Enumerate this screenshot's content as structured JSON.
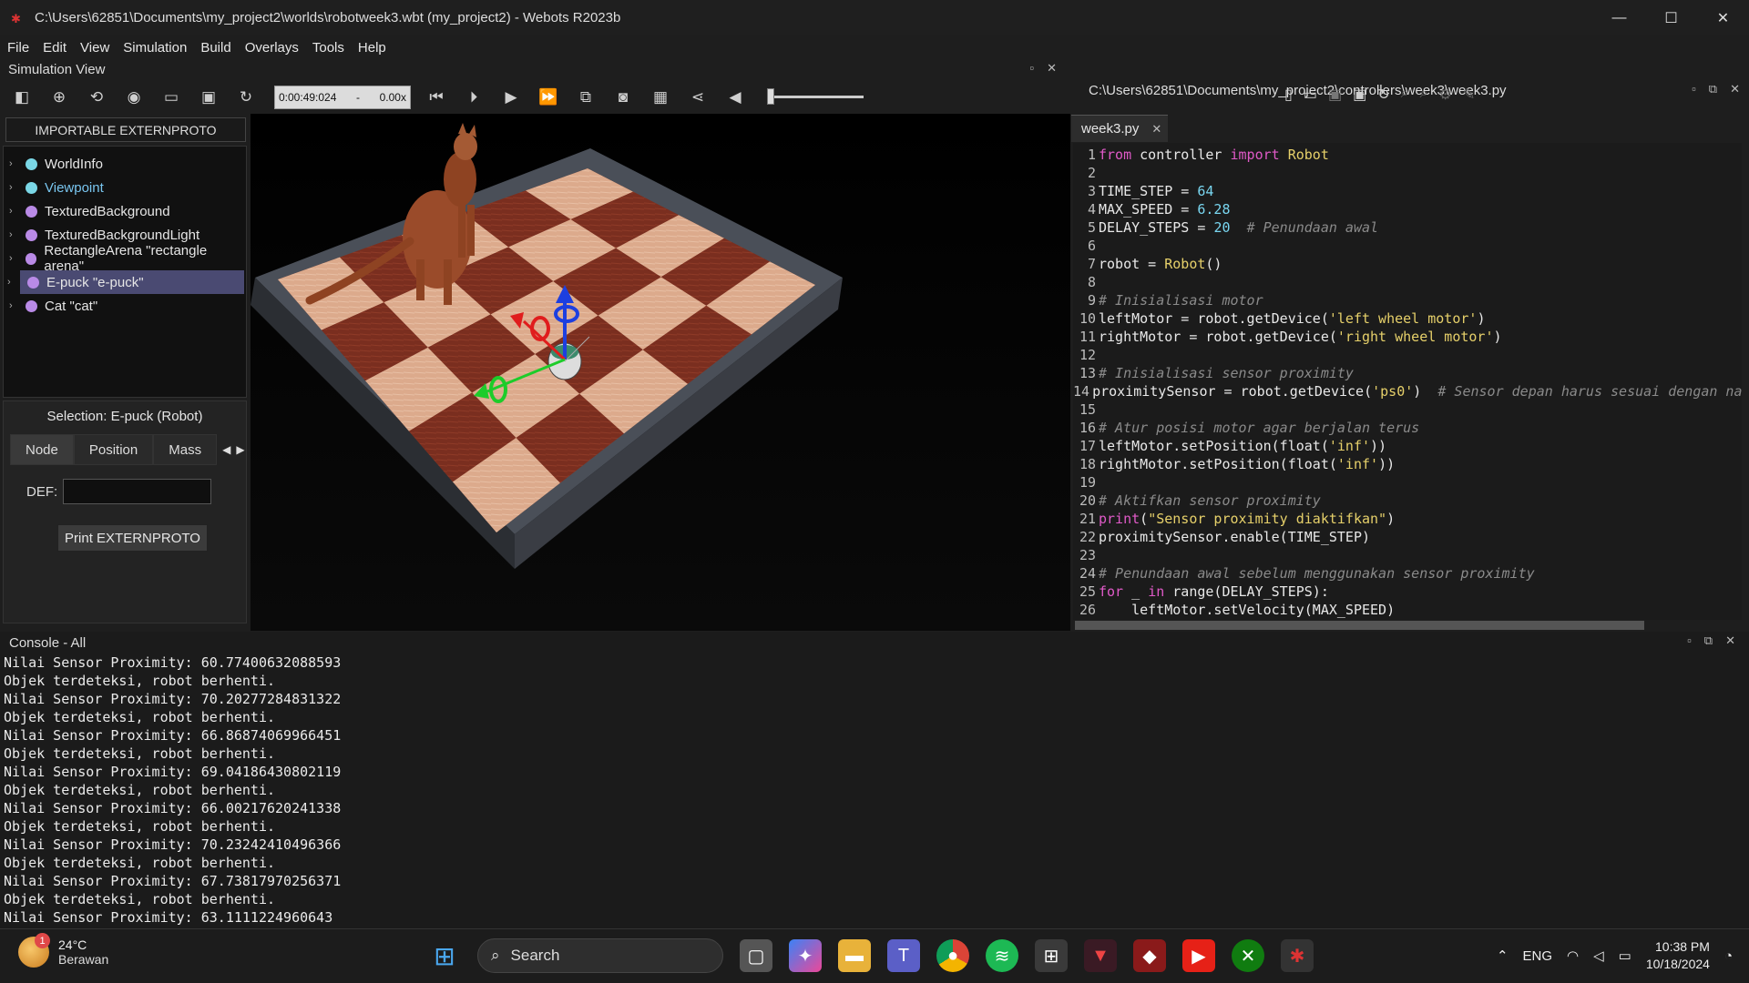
{
  "window": {
    "title": "C:\\Users\\62851\\Documents\\my_project2\\worlds\\robotweek3.wbt (my_project2) - Webots R2023b",
    "controls": [
      "—",
      "☐",
      "✕"
    ]
  },
  "menu": [
    "File",
    "Edit",
    "View",
    "Simulation",
    "Build",
    "Overlays",
    "Tools",
    "Help"
  ],
  "simulation_view": {
    "title": "Simulation View",
    "time": "0:00:49:024",
    "speed_sep": "-",
    "speed": "0.00x",
    "volume_level": 0.0
  },
  "scene_tree": {
    "header": "IMPORTABLE EXTERNPROTO",
    "items": [
      {
        "label": "WorldInfo",
        "color": "#7ad7e6"
      },
      {
        "label": "Viewpoint",
        "color": "#7ad7e6",
        "text_color": "#79c6f0"
      },
      {
        "label": "TexturedBackground",
        "color": "#b98ae6"
      },
      {
        "label": "TexturedBackgroundLight",
        "color": "#b98ae6"
      },
      {
        "label": "RectangleArena \"rectangle arena\"",
        "color": "#b98ae6"
      },
      {
        "label": "E-puck \"e-puck\"",
        "color": "#b98ae6",
        "selected": true
      },
      {
        "label": "Cat \"cat\"",
        "color": "#b98ae6"
      }
    ]
  },
  "selection": {
    "title": "Selection: E-puck (Robot)",
    "tabs": [
      "Node",
      "Position",
      "Mass"
    ],
    "def_label": "DEF:",
    "def_value": "",
    "print_button": "Print EXTERNPROTO"
  },
  "editor": {
    "path": "C:\\Users\\62851\\Documents\\my_project2\\controllers\\week3\\week3.py",
    "tab": "week3.py",
    "lines": [
      [
        [
          "kw",
          "from"
        ],
        [
          "p",
          " controller "
        ],
        [
          "kw",
          "import"
        ],
        [
          "p",
          " "
        ],
        [
          "cls",
          "Robot"
        ]
      ],
      [],
      [
        [
          "p",
          "TIME_STEP = "
        ],
        [
          "num",
          "64"
        ]
      ],
      [
        [
          "p",
          "MAX_SPEED = "
        ],
        [
          "num",
          "6.28"
        ]
      ],
      [
        [
          "p",
          "DELAY_STEPS = "
        ],
        [
          "num",
          "20"
        ],
        [
          "p",
          "  "
        ],
        [
          "com",
          "# Penundaan awal"
        ]
      ],
      [],
      [
        [
          "p",
          "robot = "
        ],
        [
          "cls",
          "Robot"
        ],
        [
          "p",
          "()"
        ]
      ],
      [],
      [
        [
          "com",
          "# Inisialisasi motor"
        ]
      ],
      [
        [
          "p",
          "leftMotor = robot.getDevice("
        ],
        [
          "str",
          "'left wheel motor'"
        ],
        [
          "p",
          ")"
        ]
      ],
      [
        [
          "p",
          "rightMotor = robot.getDevice("
        ],
        [
          "str",
          "'right wheel motor'"
        ],
        [
          "p",
          ")"
        ]
      ],
      [],
      [
        [
          "com",
          "# Inisialisasi sensor proximity"
        ]
      ],
      [
        [
          "p",
          "proximitySensor = robot.getDevice("
        ],
        [
          "str",
          "'ps0'"
        ],
        [
          "p",
          ")  "
        ],
        [
          "com",
          "# Sensor depan harus sesuai dengan na"
        ]
      ],
      [],
      [
        [
          "com",
          "# Atur posisi motor agar berjalan terus"
        ]
      ],
      [
        [
          "p",
          "leftMotor.setPosition(float("
        ],
        [
          "str",
          "'inf'"
        ],
        [
          "p",
          "))"
        ]
      ],
      [
        [
          "p",
          "rightMotor.setPosition(float("
        ],
        [
          "str",
          "'inf'"
        ],
        [
          "p",
          "))"
        ]
      ],
      [],
      [
        [
          "com",
          "# Aktifkan sensor proximity"
        ]
      ],
      [
        [
          "kw",
          "print"
        ],
        [
          "p",
          "("
        ],
        [
          "str",
          "\"Sensor proximity diaktifkan\""
        ],
        [
          "p",
          ")"
        ]
      ],
      [
        [
          "p",
          "proximitySensor.enable(TIME_STEP)"
        ]
      ],
      [],
      [
        [
          "com",
          "# Penundaan awal sebelum menggunakan sensor proximity"
        ]
      ],
      [
        [
          "kw",
          "for"
        ],
        [
          "p",
          " _ "
        ],
        [
          "kw",
          "in"
        ],
        [
          "p",
          " range(DELAY_STEPS):"
        ]
      ],
      [
        [
          "p",
          "    leftMotor.setVelocity(MAX_SPEED)"
        ]
      ]
    ]
  },
  "console": {
    "title": "Console - All",
    "lines": [
      "Nilai Sensor Proximity: 60.77400632088593",
      "Objek terdeteksi, robot berhenti.",
      "Nilai Sensor Proximity: 70.20277284831322",
      "Objek terdeteksi, robot berhenti.",
      "Nilai Sensor Proximity: 66.86874069966451",
      "Objek terdeteksi, robot berhenti.",
      "Nilai Sensor Proximity: 69.04186430802119",
      "Objek terdeteksi, robot berhenti.",
      "Nilai Sensor Proximity: 66.00217620241338",
      "Objek terdeteksi, robot berhenti.",
      "Nilai Sensor Proximity: 70.23242410496366",
      "Objek terdeteksi, robot berhenti.",
      "Nilai Sensor Proximity: 67.73817970256371",
      "Objek terdeteksi, robot berhenti.",
      "Nilai Sensor Proximity: 63.1111224960643"
    ]
  },
  "taskbar": {
    "weather_temp": "24°C",
    "weather_cond": "Berawan",
    "weather_badge": "1",
    "search_label": "Search",
    "lang": "ENG",
    "time": "10:38 PM",
    "date": "10/18/2024"
  },
  "colors": {
    "keyword": "#e05ac8",
    "class": "#e6d06a",
    "number": "#79d6f0",
    "string": "#e6d06a",
    "comment": "#8a8a8a",
    "tree_selected": "#4a4a72"
  }
}
